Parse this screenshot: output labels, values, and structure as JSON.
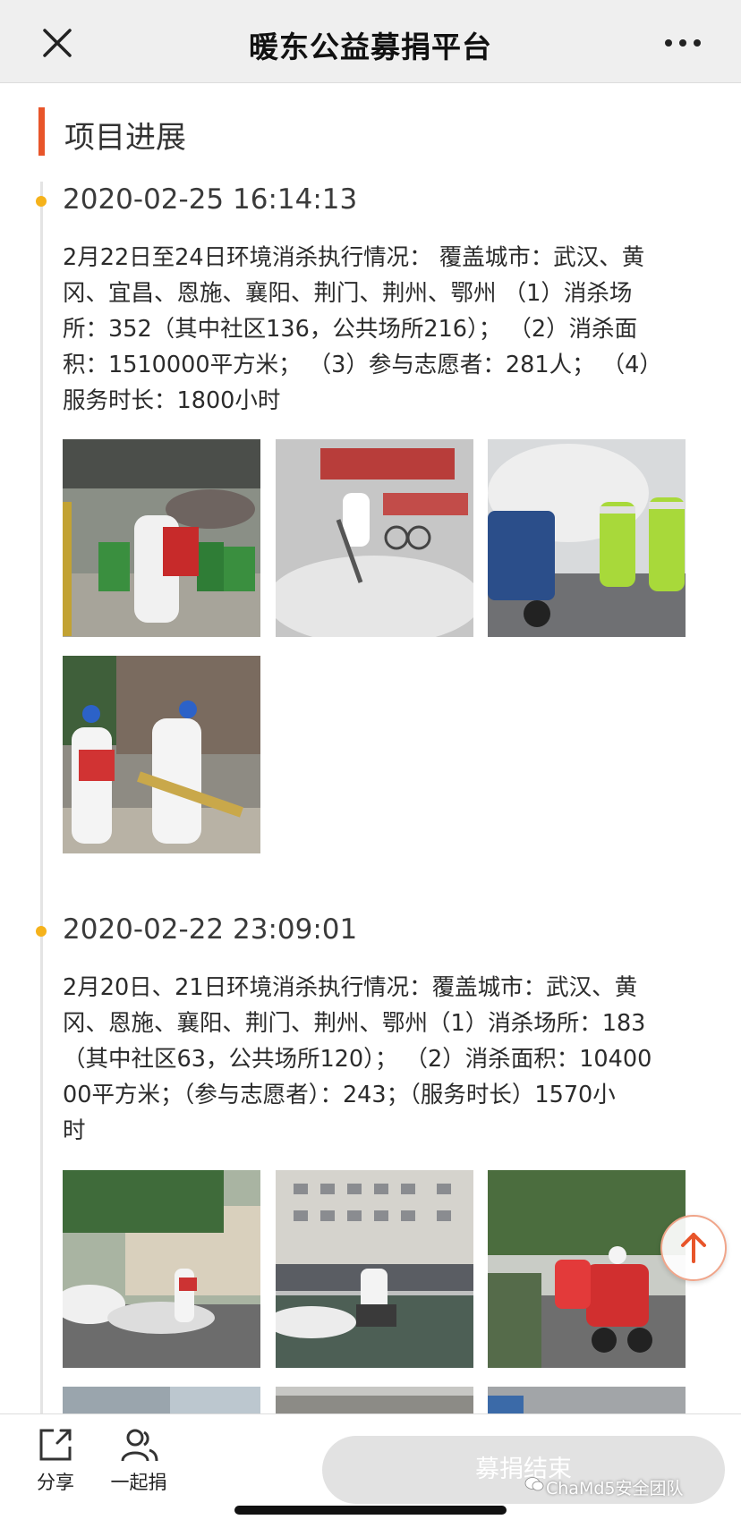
{
  "nav": {
    "title": "暖东公益募捐平台"
  },
  "section": {
    "title": "项目进展"
  },
  "entries": [
    {
      "time": "2020-02-25 16:14:13",
      "lines": [
        "2月22日至24日环境消杀执行情况：  覆盖城市：武汉、黄",
        "冈、宜昌、恩施、襄阳、荆门、荆州、鄂州 （1）消杀场",
        "所：352（其中社区136，公共场所216）；  （2）消杀面",
        "积：1510000平方米；  （3）参与志愿者：281人；  （4）",
        "服务时长：1800小时"
      ],
      "photos": [
        "disinfection-photo",
        "disinfection-photo",
        "disinfection-photo",
        "disinfection-photo"
      ]
    },
    {
      "time": "2020-02-22 23:09:01",
      "lines": [
        "2月20日、21日环境消杀执行情况：覆盖城市：武汉、黄",
        "冈、恩施、襄阳、荆门、荆州、鄂州（1）消杀场所：183",
        "（其中社区63，公共场所120）；  （2）消杀面积：10400",
        "00平方米；（参与志愿者）：243；（服务时长）1570小",
        "时"
      ],
      "photos": [
        "disinfection-photo",
        "disinfection-photo",
        "disinfection-photo"
      ]
    }
  ],
  "bottom": {
    "share_label": "分享",
    "together_label": "一起捐",
    "donate_label": "募捐结束"
  },
  "watermark": "ChaMd5安全团队",
  "colors": {
    "accent": "#e8552a",
    "timeline_dot": "#f5b21b",
    "nav_bg": "#efefef",
    "disabled_button": "#e2e2e2"
  },
  "icons": [
    "close-icon",
    "more-icon",
    "arrow-up-icon",
    "share-icon",
    "people-icon",
    "wechat-icon"
  ]
}
